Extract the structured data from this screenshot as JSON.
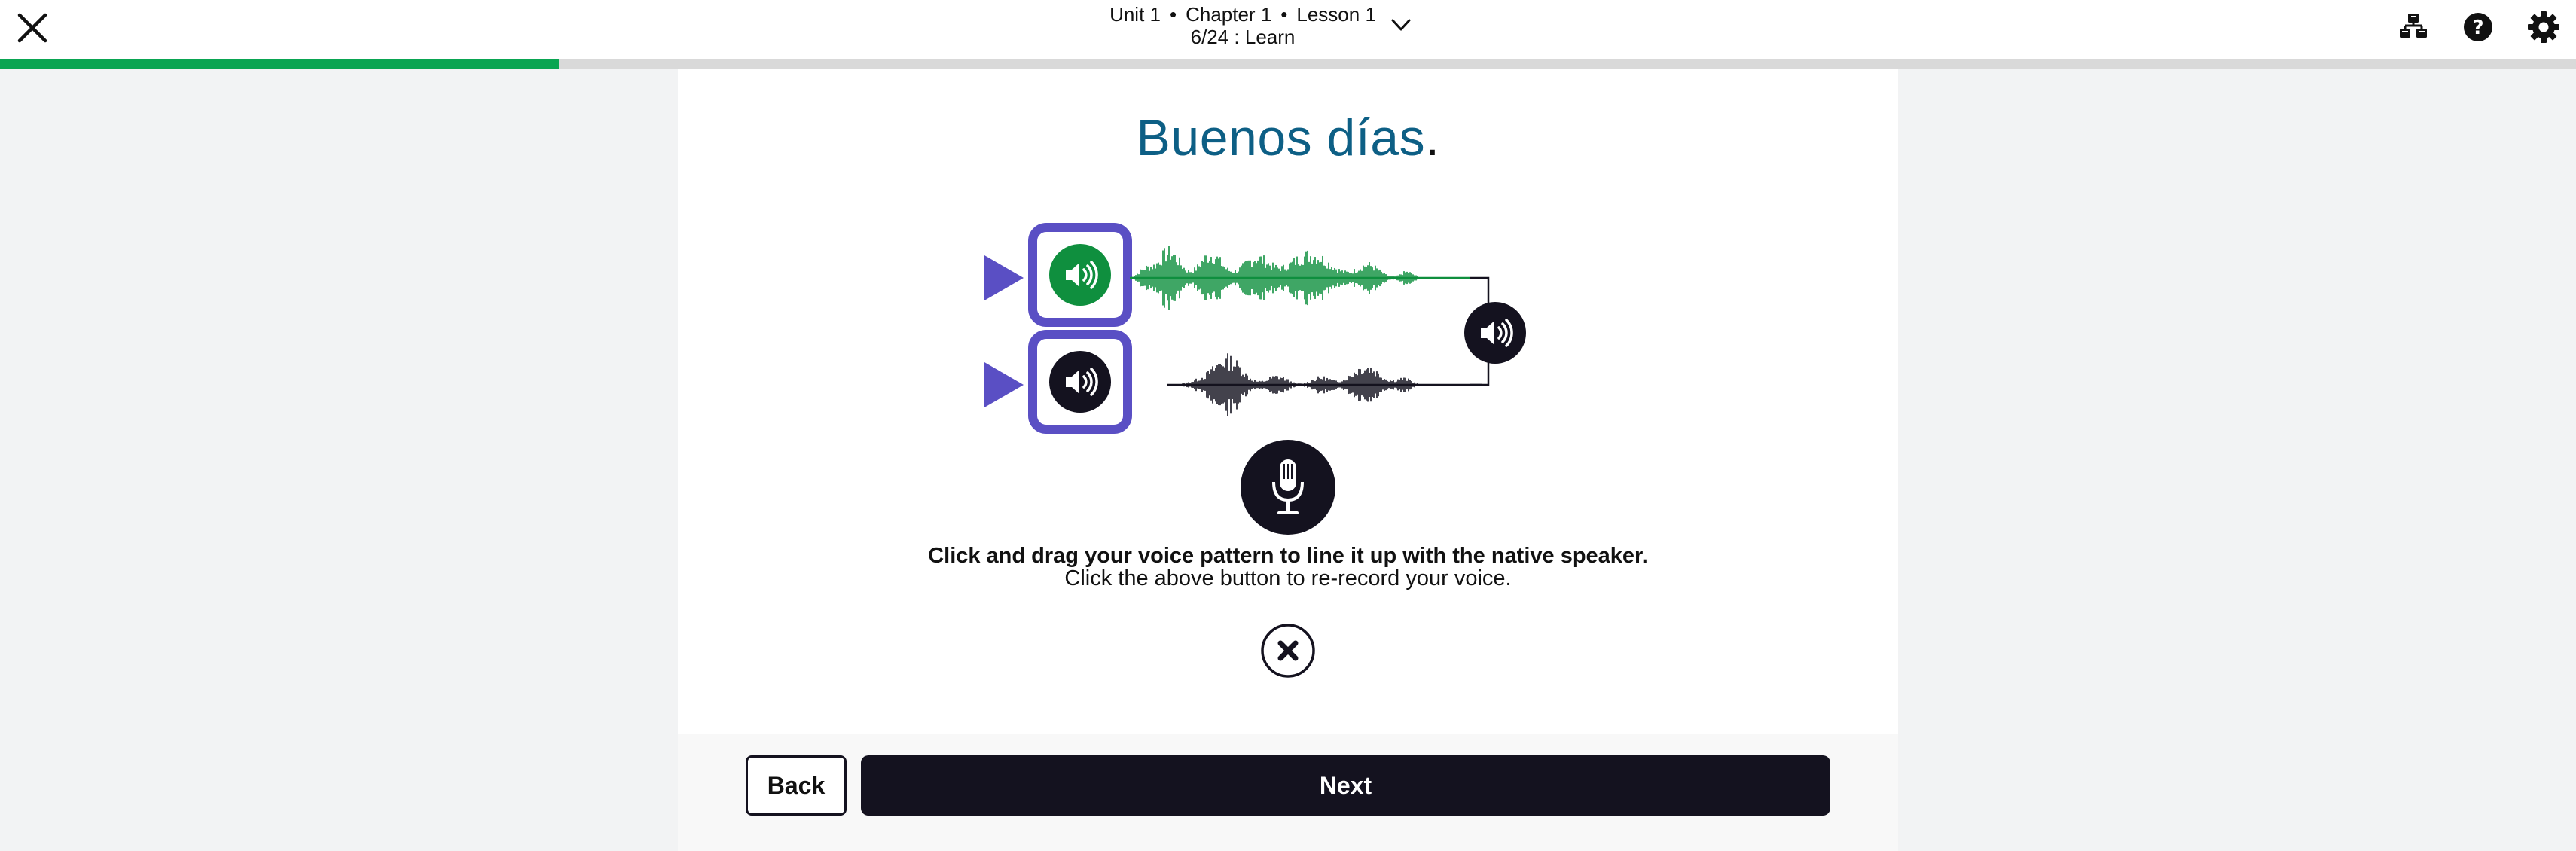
{
  "header": {
    "breadcrumb": {
      "unit": "Unit 1",
      "chapter": "Chapter 1",
      "lesson": "Lesson 1",
      "separator": "•",
      "step": "6/24 : Learn"
    },
    "icons": {
      "close": "close-icon",
      "chevron": "chevron-down-icon",
      "outline": "lesson-map-icon",
      "help": "help-icon",
      "settings": "gear-icon"
    },
    "progress_fraction": 0.217
  },
  "lesson": {
    "phrase_text": "Buenos días",
    "phrase_punct": ".",
    "native_track": {
      "icon": "speaker-icon",
      "color": "#0f8f3e"
    },
    "user_track": {
      "icon": "speaker-icon",
      "color": "#14121f"
    },
    "combined_playback_icon": "speaker-icon",
    "instruction_primary": "Click and drag your voice pattern to line it up with the native speaker.",
    "instruction_secondary": "Click the above button to re-record your voice."
  },
  "footer": {
    "back_label": "Back",
    "next_label": "Next"
  },
  "colors": {
    "accent_purple": "#5a4fc4",
    "progress_green": "#0aa552",
    "phrase_blue": "#0d5f85",
    "native_green": "#0f8f3e",
    "dark": "#14121f"
  }
}
